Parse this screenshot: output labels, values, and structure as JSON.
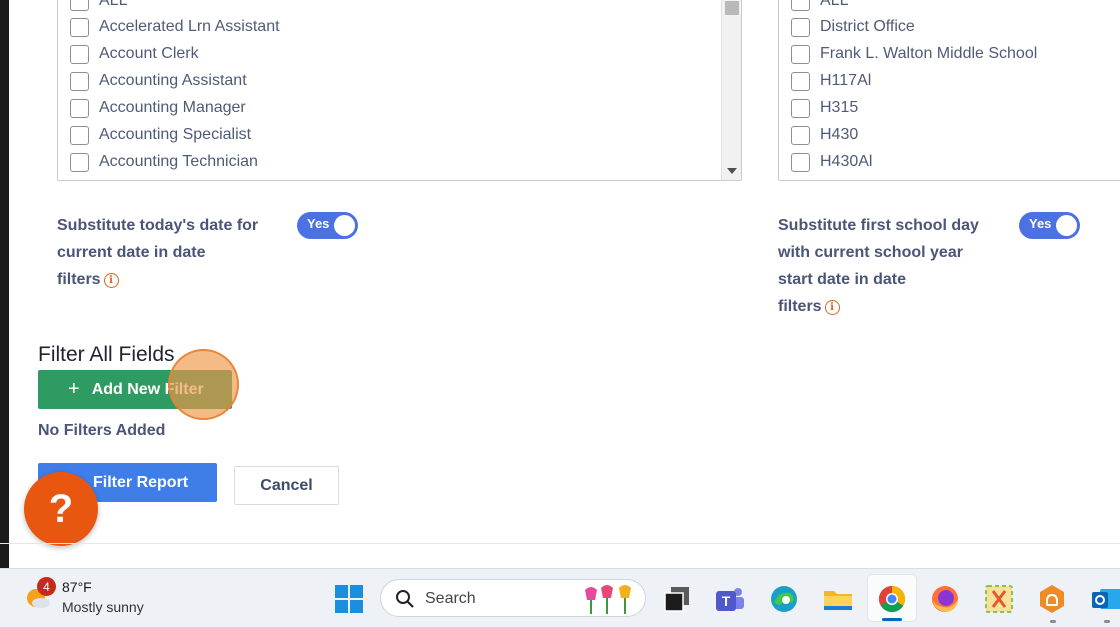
{
  "left_list": {
    "items": [
      "ALL",
      "Accelerated Lrn Assistant",
      "Account Clerk",
      "Accounting Assistant",
      "Accounting Manager",
      "Accounting Specialist",
      "Accounting Technician"
    ]
  },
  "right_list": {
    "items": [
      "ALL",
      "District Office",
      "Frank L. Walton Middle School",
      "H117Al",
      "H315",
      "H430",
      "H430Al"
    ]
  },
  "options": {
    "substitute_today": {
      "label_lines": [
        "Substitute today's date for",
        "current date in date",
        "filters"
      ],
      "toggle": "Yes"
    },
    "substitute_school_day": {
      "label_lines": [
        "Substitute first school day",
        "with current school year",
        "start date in date",
        "filters"
      ],
      "toggle": "Yes"
    }
  },
  "filter_section": {
    "title": "Filter All Fields",
    "add_button": "Add New Filter",
    "empty_text": "No Filters Added"
  },
  "actions": {
    "filter_report": "Filter Report",
    "cancel": "Cancel",
    "help": "?"
  },
  "taskbar": {
    "weather_badge": "4",
    "temperature": "87°F",
    "condition": "Mostly sunny",
    "search_placeholder": "Search"
  },
  "colors": {
    "toggle_on": "#4b71e2",
    "add_button": "#2e9c62",
    "filter_button": "#3f7de8",
    "help_button": "#e8560f",
    "info_icon": "#d9651f"
  }
}
